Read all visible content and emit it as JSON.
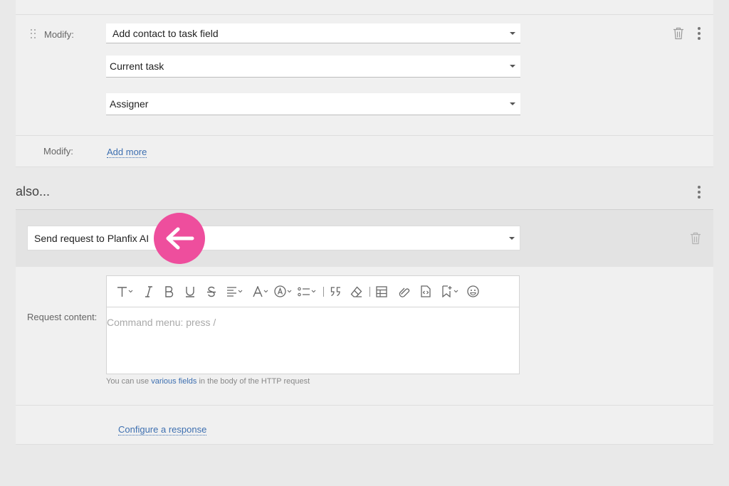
{
  "modify_block": {
    "modify_label": "Modify:",
    "action_select": "Add contact to task field",
    "target_select": "Current task",
    "field_select": "Assigner"
  },
  "add_more_row": {
    "modify_label": "Modify:",
    "add_more_link": "Add more"
  },
  "also_section": {
    "title": "also...",
    "action_select": "Send request to Planfix AI",
    "request_label": "Request content:",
    "editor_placeholder": "Command menu: press /",
    "hint_prefix": "You can use ",
    "hint_link": "various fields",
    "hint_suffix": " in the body of the HTTP request",
    "configure_link": "Configure a response"
  },
  "toolbar_icons": [
    "text-style-icon",
    "italic-icon",
    "bold-icon",
    "underline-icon",
    "strikethrough-icon",
    "align-icon",
    "font-color-icon",
    "highlight-icon",
    "list-icon",
    "quote-icon",
    "eraser-icon",
    "table-icon",
    "attach-icon",
    "code-icon",
    "bookmark-icon",
    "emoji-icon"
  ],
  "colors": {
    "accent_link": "#3d6fb0",
    "highlight_badge": "#ee4e9d"
  }
}
